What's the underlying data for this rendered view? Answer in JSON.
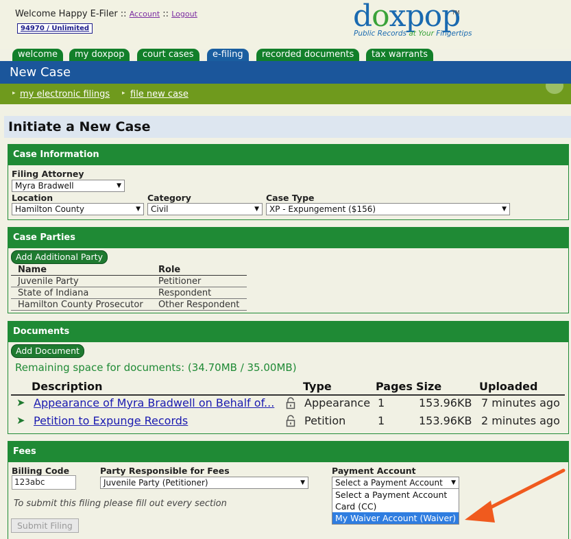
{
  "header": {
    "welcome_text": "Welcome Happy E-Filer ::",
    "account_link": "Account",
    "sep": "::",
    "logout_link": "Logout",
    "account_box": "94970 / Unlimited",
    "logo_word_start": "d",
    "logo_word_o": "o",
    "logo_word_end": "xpop",
    "logo_tm": "TM",
    "logo_tag_a": "Public Records",
    "logo_tag_b": "at Your",
    "logo_tag_c": "Fingertips"
  },
  "tabs": [
    {
      "label": "welcome"
    },
    {
      "label": "my doxpop"
    },
    {
      "label": "court cases"
    },
    {
      "label": "e-filing"
    },
    {
      "label": "recorded documents"
    },
    {
      "label": "tax warrants"
    }
  ],
  "title_bar": "New Case",
  "subnav": {
    "item1": "my electronic filings",
    "item2": "file new case"
  },
  "page_title": "Initiate a New Case",
  "case_info": {
    "header": "Case Information",
    "filing_attorney_label": "Filing Attorney",
    "filing_attorney_value": "Myra Bradwell",
    "location_label": "Location",
    "location_value": "Hamilton County",
    "category_label": "Category",
    "category_value": "Civil",
    "case_type_label": "Case Type",
    "case_type_value": "XP - Expungement ($156)"
  },
  "case_parties": {
    "header": "Case Parties",
    "add_button": "Add Additional Party",
    "col_name": "Name",
    "col_role": "Role",
    "rows": [
      {
        "name": "Juvenile Party",
        "role": "Petitioner"
      },
      {
        "name": "State of Indiana",
        "role": "Respondent"
      },
      {
        "name": "Hamilton County Prosecutor",
        "role": "Other Respondent"
      }
    ]
  },
  "documents": {
    "header": "Documents",
    "add_button": "Add Document",
    "remaining": "Remaining space for documents: (34.70MB / 35.00MB)",
    "columns": {
      "description": "Description",
      "type": "Type",
      "pages": "Pages",
      "size": "Size",
      "uploaded": "Uploaded"
    },
    "rows": [
      {
        "description": "Appearance of Myra Bradwell on Behalf of...",
        "type": "Appearance",
        "pages": "1",
        "size": "153.96KB",
        "uploaded": "7 minutes ago"
      },
      {
        "description": "Petition to Expunge Records",
        "type": "Petition",
        "pages": "1",
        "size": "153.96KB",
        "uploaded": "2 minutes ago"
      }
    ]
  },
  "fees": {
    "header": "Fees",
    "billing_code_label": "Billing Code",
    "billing_code_value": "123abc",
    "party_label": "Party Responsible for Fees",
    "party_value": "Juvenile Party (Petitioner)",
    "payment_label": "Payment Account",
    "payment_value": "Select a Payment Account",
    "payment_options": [
      "Select a Payment Account",
      "Card (CC)",
      "My Waiver Account (Waiver)"
    ],
    "note": "To submit this filing please fill out every section",
    "submit_button": "Submit Filing"
  },
  "colors": {
    "tab_green": "#127f2a",
    "active_tab": "#1a5ea0",
    "title_blue": "#1b569b",
    "subnav_olive": "#6f9a1d",
    "section_green": "#1f8a35",
    "annotation_arrow": "#f05a1e"
  }
}
